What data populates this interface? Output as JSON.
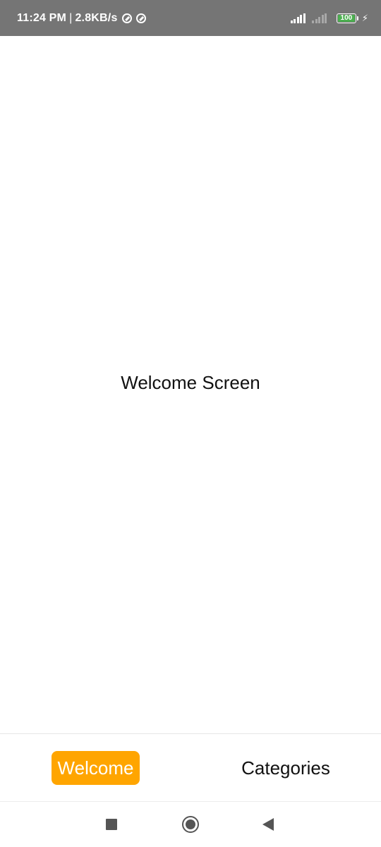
{
  "status_bar": {
    "time": "11:24 PM",
    "separator": "|",
    "network_speed": "2.8KB/s",
    "battery_level": "100",
    "icons": [
      "data-saver-icon",
      "data-saver-icon",
      "signal-icon",
      "signal-empty-icon",
      "battery-icon",
      "charging-bolt-icon"
    ]
  },
  "main": {
    "title": "Welcome Screen"
  },
  "tab_bar": {
    "active_color": "#FFA500",
    "tabs": [
      {
        "label": "Welcome",
        "active": true
      },
      {
        "label": "Categories",
        "active": false
      }
    ]
  },
  "nav_bar": {
    "buttons": [
      "recent-apps-icon",
      "home-icon",
      "back-icon"
    ]
  }
}
